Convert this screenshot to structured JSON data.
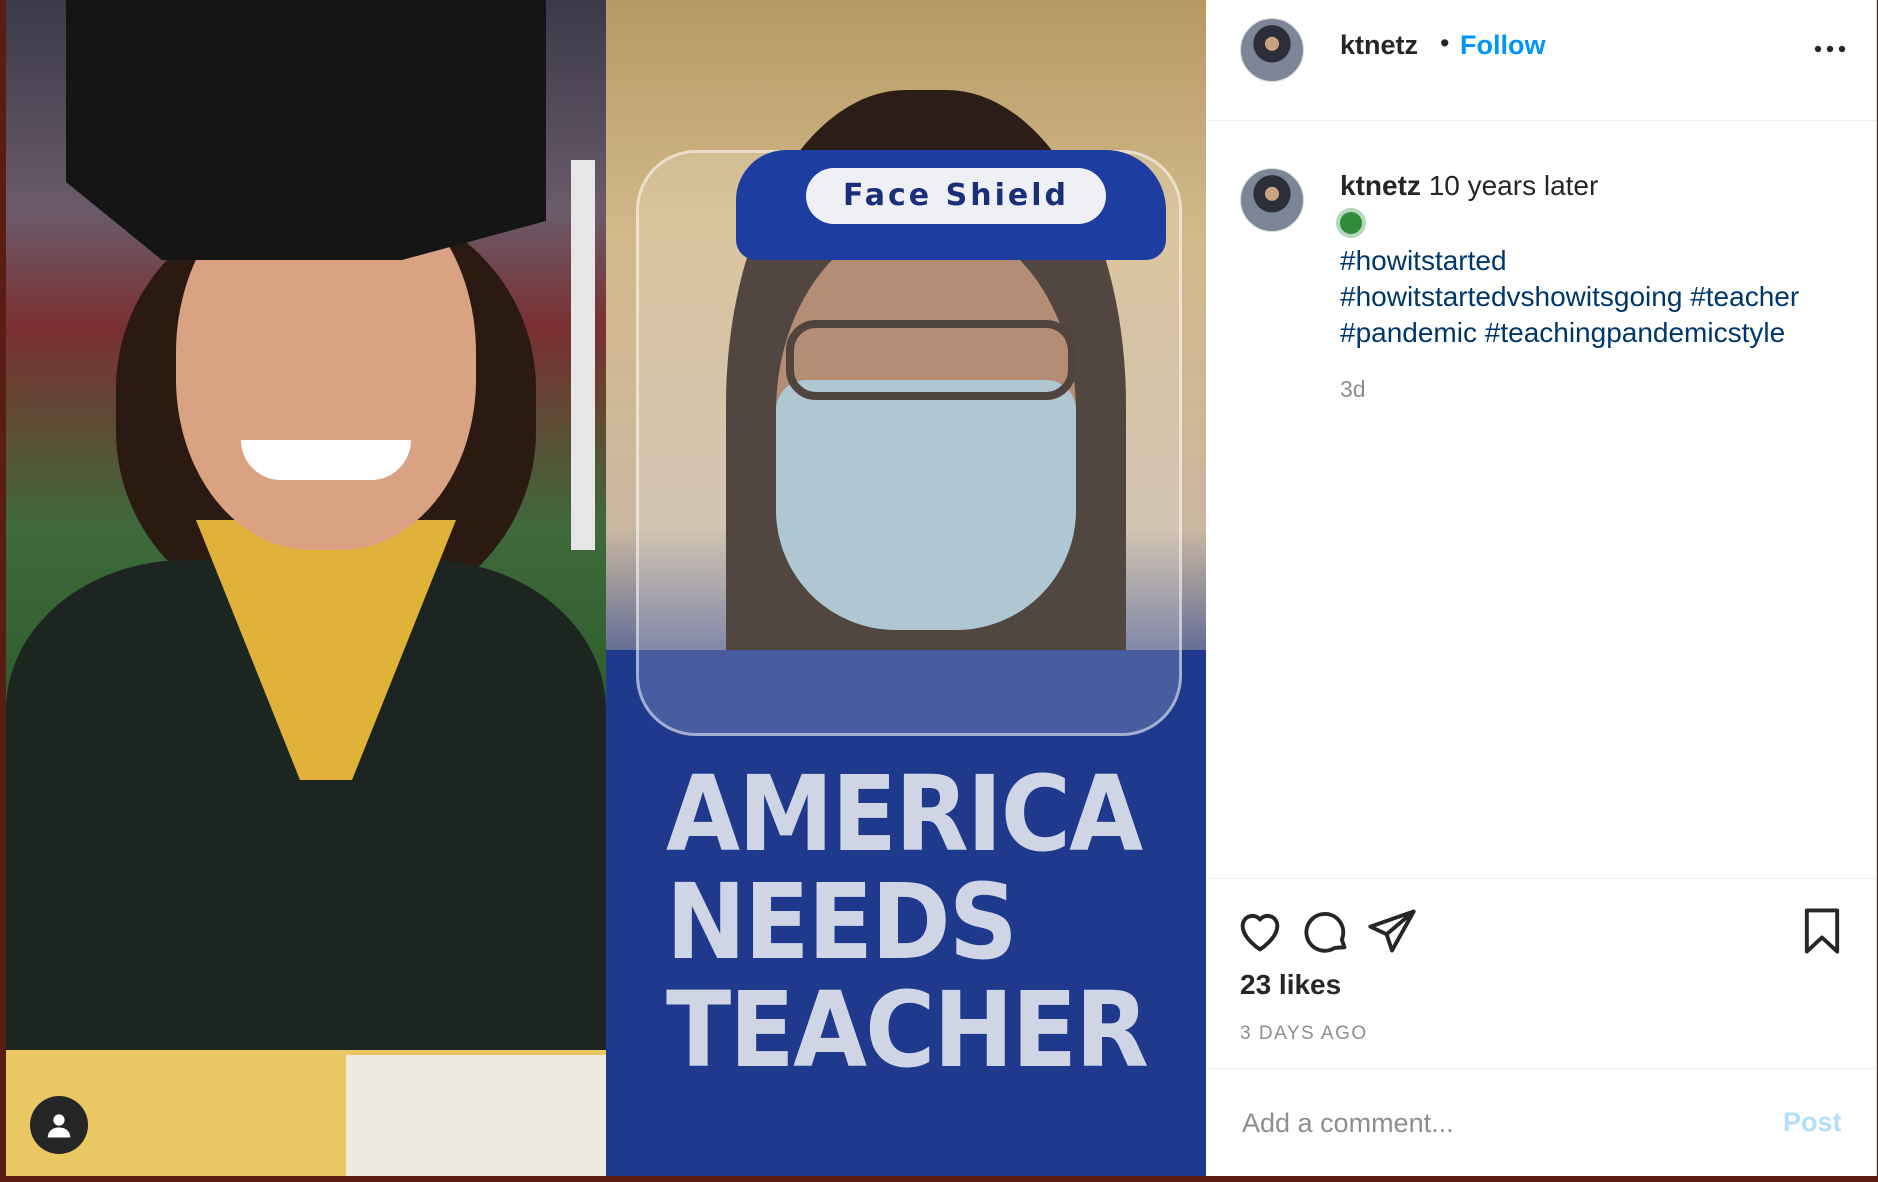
{
  "header": {
    "username": "ktnetz",
    "separator": "•",
    "follow_label": "Follow"
  },
  "caption": {
    "username": "ktnetz",
    "text": "10 years later",
    "emoji": "microbe-emoji",
    "hashtags": [
      "#howitstarted",
      "#howitstartedvshowitsgoing",
      "#teacher",
      "#pandemic",
      "#teachingpandemicstyle"
    ],
    "time": "3d"
  },
  "photo": {
    "face_shield_label": "Face Shield",
    "shirt_text": [
      "AMERICA",
      "NEEDS",
      "TEACHER"
    ]
  },
  "engagement": {
    "likes": "23 likes",
    "posted": "3 DAYS AGO"
  },
  "comment": {
    "placeholder": "Add a comment...",
    "post_label": "Post"
  },
  "colors": {
    "link_blue": "#0095f6",
    "hashtag_blue": "#00376b",
    "post_disabled": "#b2dffc",
    "muted_text": "#8e8e8e"
  }
}
